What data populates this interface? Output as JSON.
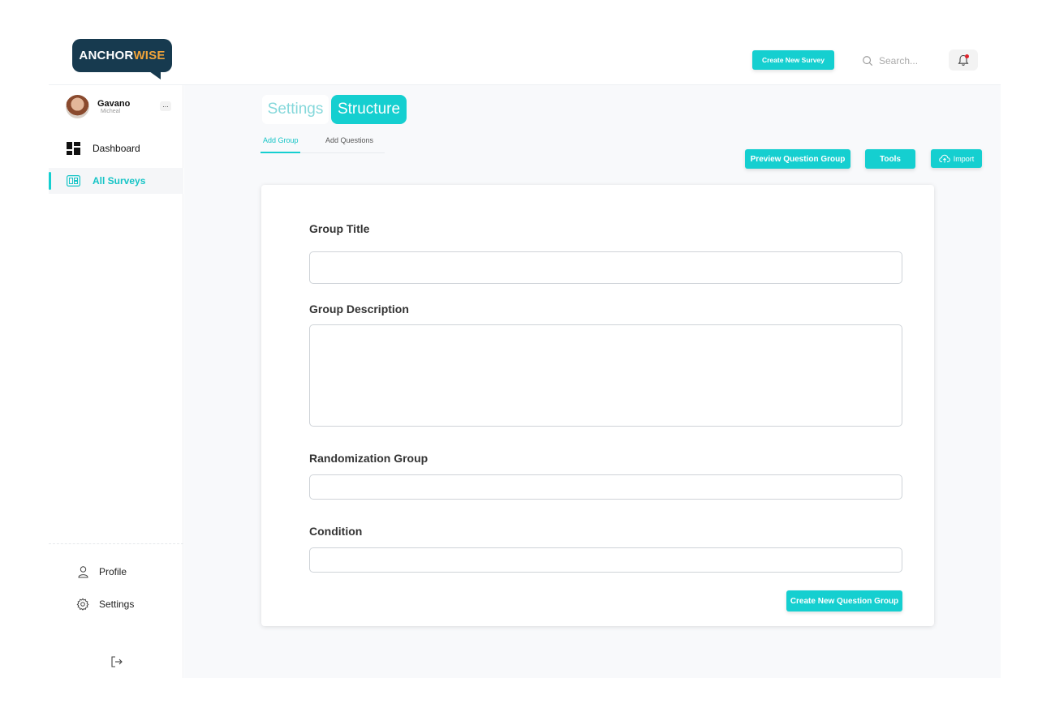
{
  "brand": {
    "logo_main": "ANCHOR",
    "logo_accent": "WISE"
  },
  "header": {
    "create_survey_label": "Create New Survey",
    "search_placeholder": "Search..."
  },
  "user": {
    "name": "Gavano",
    "role": "Micheal"
  },
  "sidebar": {
    "items": [
      {
        "label": "Dashboard"
      },
      {
        "label": "All Surveys"
      }
    ],
    "bottom": [
      {
        "label": "Profile"
      },
      {
        "label": "Settings"
      }
    ]
  },
  "main": {
    "tabs": [
      {
        "label": "Settings"
      },
      {
        "label": "Structure"
      }
    ],
    "subtabs": [
      {
        "label": "Add Group"
      },
      {
        "label": "Add Questions"
      }
    ],
    "actions": {
      "preview_label": "Preview Question Group",
      "tools_label": "Tools",
      "import_label": "Import"
    },
    "form": {
      "group_title_label": "Group Title",
      "group_title_value": "",
      "group_description_label": "Group Description",
      "group_description_value": "",
      "randomization_label": "Randomization Group",
      "randomization_value": "",
      "condition_label": "Condition",
      "condition_value": "",
      "submit_label": "Create New Question Group"
    }
  },
  "colors": {
    "accent": "#15cfd0",
    "brand_dark": "#173a4f",
    "brand_orange": "#f0a33a"
  }
}
